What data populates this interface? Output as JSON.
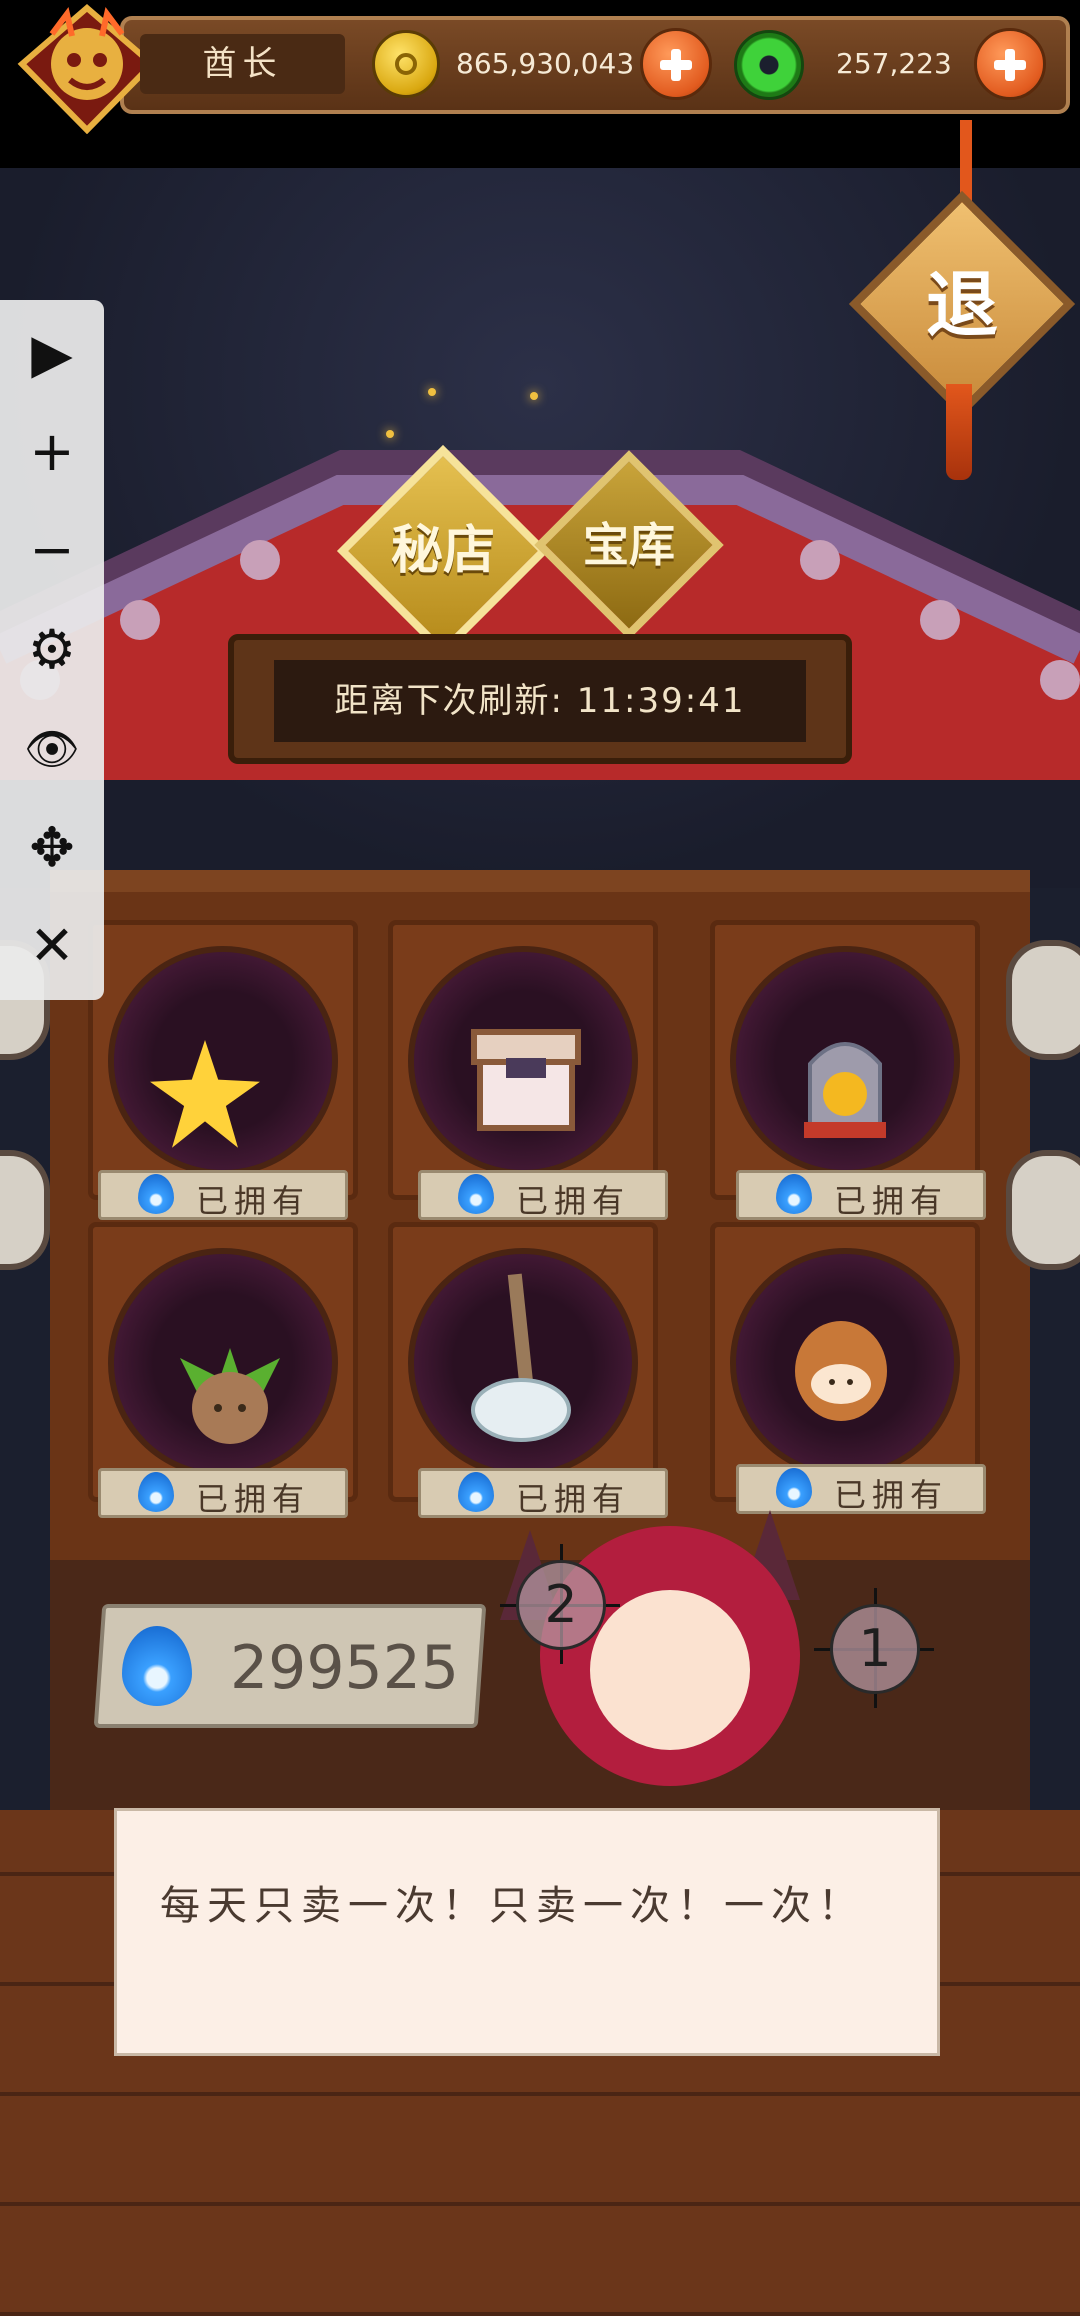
{
  "topbar": {
    "player_name": "酋长",
    "coins": "865,930,043",
    "jade": "257,223"
  },
  "exit_sign": {
    "label": "退"
  },
  "tabs": [
    {
      "label": "秘店"
    },
    {
      "label": "宝库"
    }
  ],
  "refresh_timer": "距离下次刷新: 11:39:41",
  "shop_items": [
    {
      "name": "star",
      "status": "已拥有"
    },
    {
      "name": "chest",
      "status": "已拥有"
    },
    {
      "name": "bell-jar-figure",
      "status": "已拥有"
    },
    {
      "name": "leaf-seed",
      "status": "已拥有"
    },
    {
      "name": "incense-burner",
      "status": "已拥有"
    },
    {
      "name": "bread-bun",
      "status": "已拥有"
    }
  ],
  "currency_balance": "299525",
  "markers": [
    "2",
    "1"
  ],
  "dialog": {
    "text": "每天只卖一次！只卖一次！一次！"
  },
  "toolbar": {
    "tools": [
      {
        "name": "play",
        "glyph": "▶"
      },
      {
        "name": "zoom-in",
        "glyph": "+"
      },
      {
        "name": "zoom-out",
        "glyph": "−"
      },
      {
        "name": "settings",
        "glyph": "⚙"
      },
      {
        "name": "hide",
        "glyph": "👁"
      },
      {
        "name": "move",
        "glyph": "✥"
      },
      {
        "name": "close",
        "glyph": "✕"
      }
    ]
  },
  "colors": {
    "accent": "#e25b1f",
    "gold": "#e5c050",
    "flame_blue": "#3aa0ff"
  }
}
